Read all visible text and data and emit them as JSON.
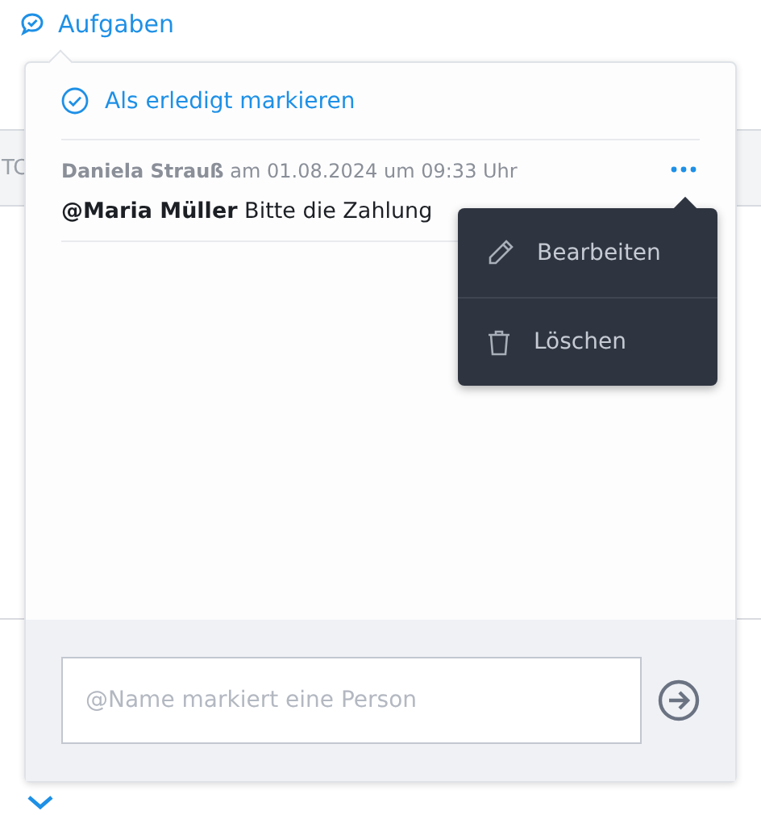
{
  "header": {
    "label": "Aufgaben"
  },
  "background": {
    "column_label": "TC"
  },
  "popup": {
    "mark_done": "Als erledigt markieren",
    "comments": [
      {
        "meta": "**Daniela Strauß** am 01.08.2024 um 09:33 Uhr",
        "text": "**@Maria Müller** Bitte die Zahlung",
        "menu_open": true
      }
    ],
    "menu": [
      {
        "kind": "edit",
        "label": "Bearbeiten"
      },
      {
        "kind": "delete",
        "label": "Löschen"
      }
    ],
    "input": {
      "placeholder": "@Name markiert eine Person"
    }
  }
}
